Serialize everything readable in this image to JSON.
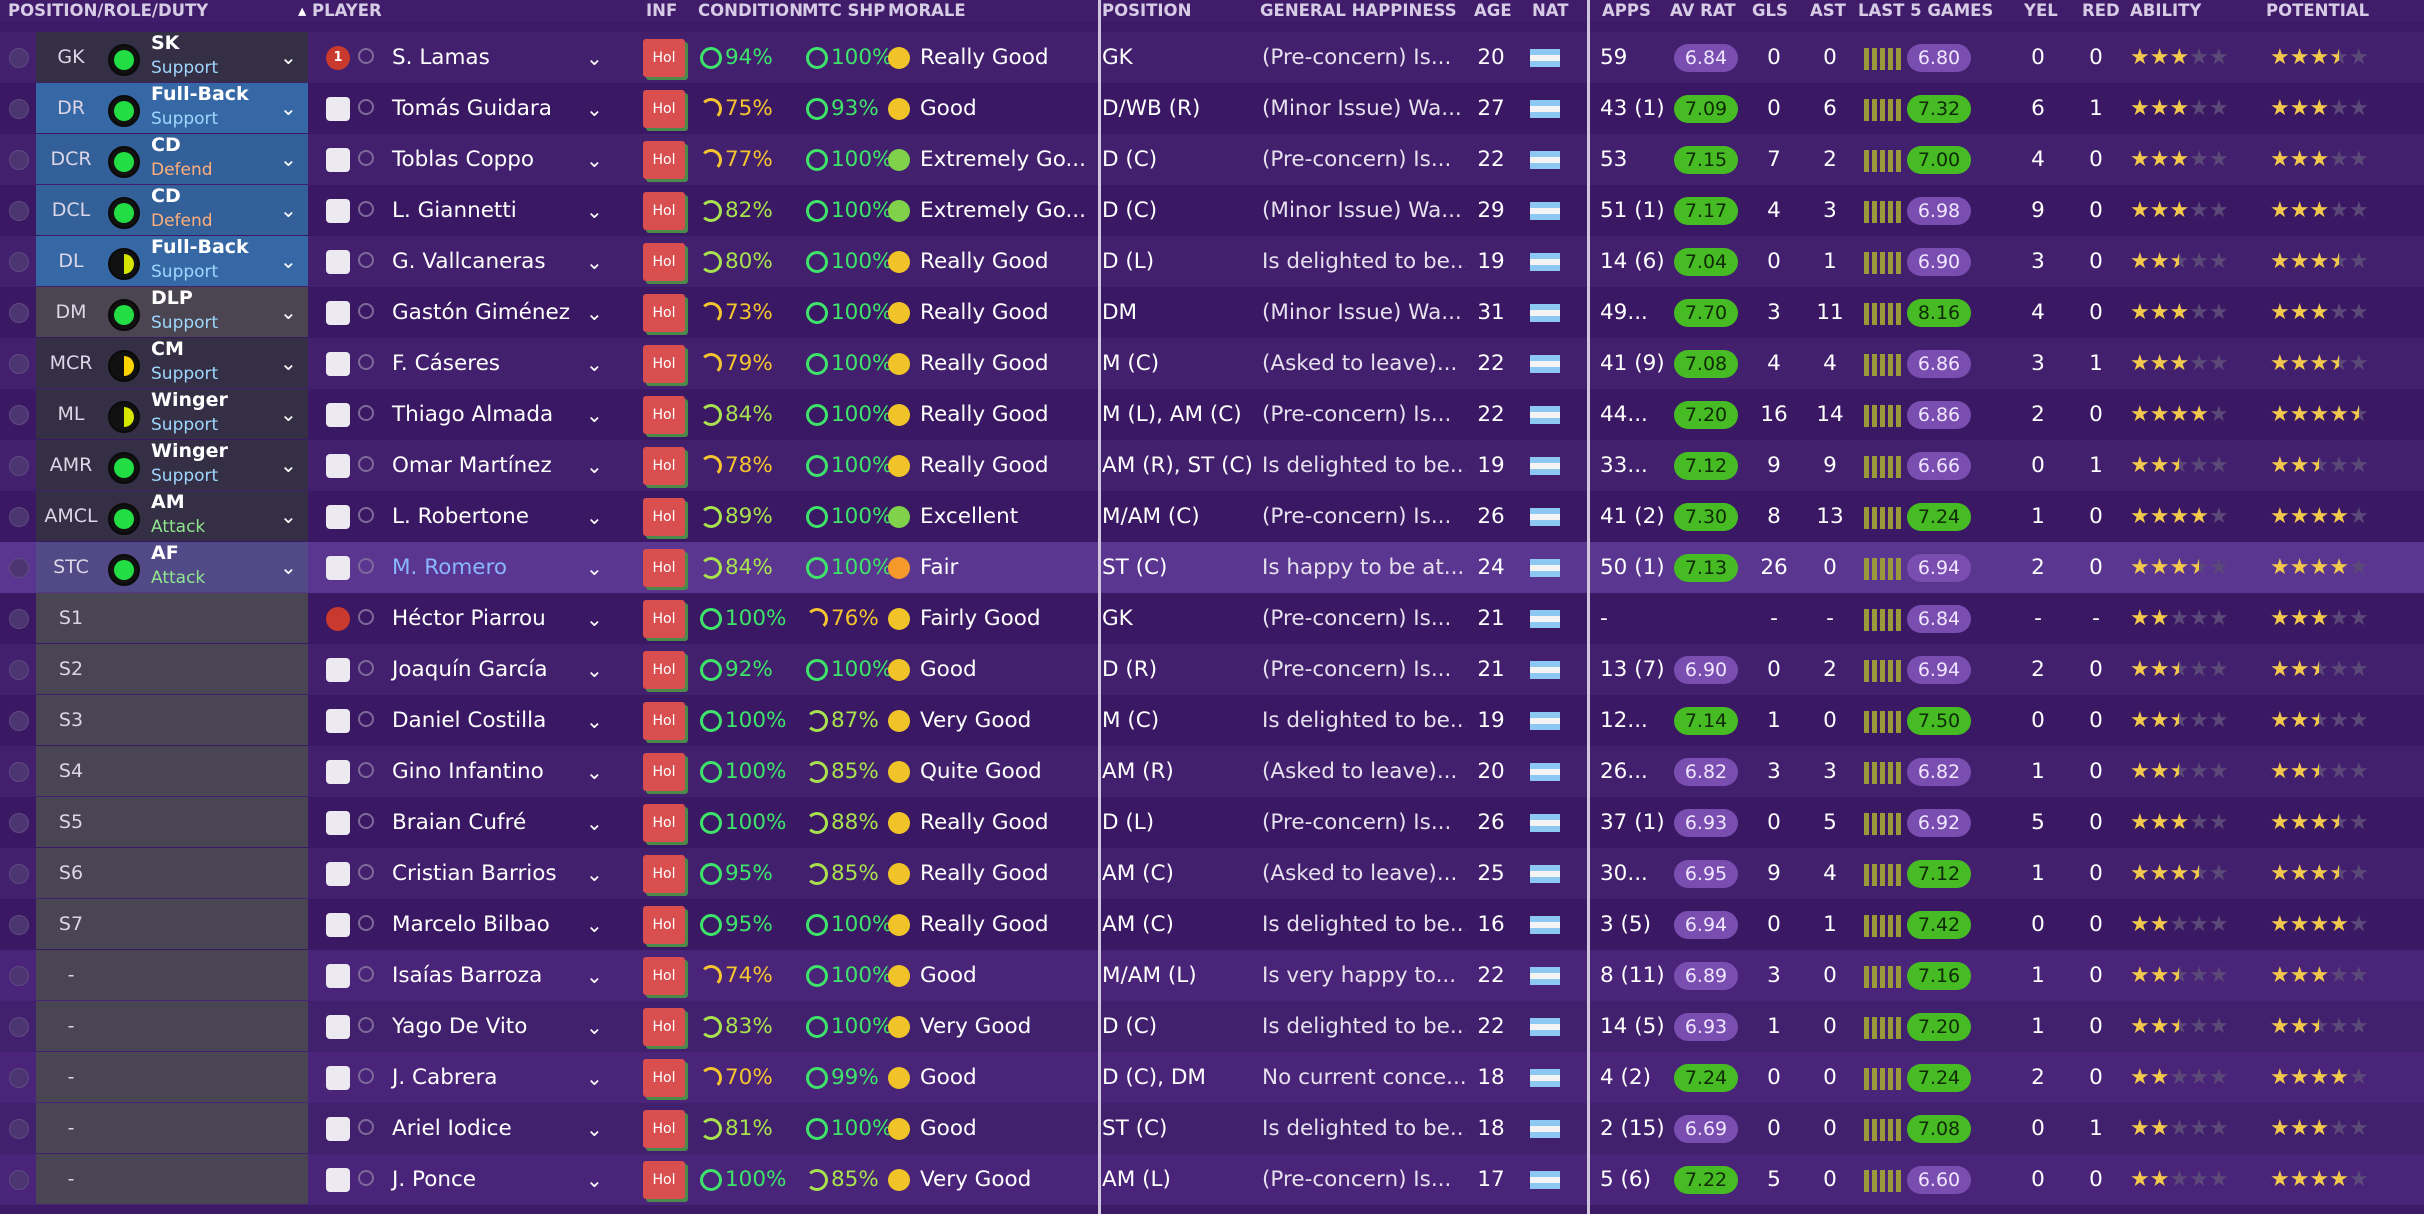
{
  "columns": {
    "position": "POSITION/ROLE/DUTY",
    "player": "PLAYER",
    "sort_indicator": "▴",
    "inf": "INF",
    "condition": "CONDITION",
    "match_sharpness": "MTC SHP",
    "morale": "MORALE",
    "position2": "POSITION",
    "happiness": "GENERAL HAPPINESS",
    "age": "AGE",
    "nat": "NAT",
    "apps": "APPS",
    "av_rat": "AV RAT",
    "gls": "GLS",
    "ast": "AST",
    "last5": "LAST 5 GAMES",
    "yel": "YEL",
    "red": "RED",
    "ability": "ABILITY",
    "potential": "POTENTIAL"
  },
  "players": [
    {
      "pos": "GK",
      "role": "SK",
      "duty": "Support",
      "name": "S. Lamas",
      "shirt": "1",
      "gk": true,
      "inf": "Hol",
      "cond": "94%",
      "mtc": "100%",
      "morale": "Really Good",
      "position": "GK",
      "happy": "(Pre-concern) Is...",
      "age": "20",
      "apps": "59",
      "avr": "6.84",
      "gls": "0",
      "ast": "0",
      "last5": "6.80",
      "yel": "0",
      "red": "0",
      "abil": "3",
      "pot": "3.5"
    },
    {
      "pos": "DR",
      "role": "Full-Back",
      "duty": "Support",
      "name": "Tomás Guidara",
      "shirt": "",
      "inf": "Hol",
      "cond": "75%",
      "mtc": "93%",
      "morale": "Good",
      "position": "D/WB (R)",
      "happy": "(Minor Issue) Wa...",
      "age": "27",
      "apps": "43 (1)",
      "avr": "7.09",
      "gls": "0",
      "ast": "6",
      "last5": "7.32",
      "yel": "6",
      "red": "1",
      "abil": "3",
      "pot": "3"
    },
    {
      "pos": "DCR",
      "role": "CD",
      "duty": "Defend",
      "name": "Toblas Coppo",
      "shirt": "",
      "inf": "Hol",
      "cond": "77%",
      "mtc": "100%",
      "morale": "Extremely Go...",
      "position": "D (C)",
      "happy": "(Pre-concern) Is...",
      "age": "22",
      "apps": "53",
      "avr": "7.15",
      "gls": "7",
      "ast": "2",
      "last5": "7.00",
      "yel": "4",
      "red": "0",
      "abil": "3",
      "pot": "3"
    },
    {
      "pos": "DCL",
      "role": "CD",
      "duty": "Defend",
      "name": "L. Giannetti",
      "shirt": "",
      "inf": "Hol",
      "cond": "82%",
      "mtc": "100%",
      "morale": "Extremely Go...",
      "position": "D (C)",
      "happy": "(Minor Issue) Wa...",
      "age": "29",
      "apps": "51 (1)",
      "avr": "7.17",
      "gls": "4",
      "ast": "3",
      "last5": "6.98",
      "yel": "9",
      "red": "0",
      "abil": "3",
      "pot": "3"
    },
    {
      "pos": "DL",
      "role": "Full-Back",
      "duty": "Support",
      "name": "G. Vallcaneras",
      "shirt": "",
      "inf": "Hol",
      "cond": "80%",
      "mtc": "100%",
      "morale": "Really Good",
      "position": "D (L)",
      "happy": "Is delighted to be...",
      "age": "19",
      "apps": "14 (6)",
      "avr": "7.04",
      "gls": "0",
      "ast": "1",
      "last5": "6.90",
      "yel": "3",
      "red": "0",
      "abil": "2.5",
      "pot": "3.5"
    },
    {
      "pos": "DM",
      "role": "DLP",
      "duty": "Support",
      "name": "Gastón Giménez",
      "shirt": "",
      "inf": "Hol",
      "cond": "73%",
      "mtc": "100%",
      "morale": "Really Good",
      "position": "DM",
      "happy": "(Minor Issue) Wa...",
      "age": "31",
      "apps": "49...",
      "avr": "7.70",
      "gls": "3",
      "ast": "11",
      "last5": "8.16",
      "yel": "4",
      "red": "0",
      "abil": "3",
      "pot": "3"
    },
    {
      "pos": "MCR",
      "role": "CM",
      "duty": "Support",
      "name": "F. Cáseres",
      "shirt": "",
      "inf": "Hol",
      "cond": "79%",
      "mtc": "100%",
      "morale": "Really Good",
      "position": "M (C)",
      "happy": "(Asked to leave)...",
      "age": "22",
      "apps": "41 (9)",
      "avr": "7.08",
      "gls": "4",
      "ast": "4",
      "last5": "6.86",
      "yel": "3",
      "red": "1",
      "abil": "3",
      "pot": "3.5"
    },
    {
      "pos": "ML",
      "role": "Winger",
      "duty": "Support",
      "name": "Thiago Almada",
      "shirt": "",
      "inf": "Hol",
      "cond": "84%",
      "mtc": "100%",
      "morale": "Really Good",
      "position": "M (L), AM (C)",
      "happy": "(Pre-concern) Is...",
      "age": "22",
      "apps": "44...",
      "avr": "7.20",
      "gls": "16",
      "ast": "14",
      "last5": "6.86",
      "yel": "2",
      "red": "0",
      "abil": "4",
      "pot": "4.5"
    },
    {
      "pos": "AMR",
      "role": "Winger",
      "duty": "Support",
      "name": "Omar Martínez",
      "shirt": "",
      "inf": "Hol",
      "cond": "78%",
      "mtc": "100%",
      "morale": "Really Good",
      "position": "AM (R), ST (C)",
      "happy": "Is delighted to be...",
      "age": "19",
      "apps": "33...",
      "avr": "7.12",
      "gls": "9",
      "ast": "9",
      "last5": "6.66",
      "yel": "0",
      "red": "1",
      "abil": "2.5",
      "pot": "2.5"
    },
    {
      "pos": "AMCL",
      "role": "AM",
      "duty": "Attack",
      "name": "L. Robertone",
      "shirt": "",
      "inf": "Hol",
      "cond": "89%",
      "mtc": "100%",
      "morale": "Excellent",
      "position": "M/AM (C)",
      "happy": "(Pre-concern) Is...",
      "age": "26",
      "apps": "41 (2)",
      "avr": "7.30",
      "gls": "8",
      "ast": "13",
      "last5": "7.24",
      "yel": "1",
      "red": "0",
      "abil": "4",
      "pot": "4"
    },
    {
      "pos": "STC",
      "role": "AF",
      "duty": "Attack",
      "name": "M. Romero",
      "shirt": "",
      "inf": "Hol",
      "cond": "84%",
      "mtc": "100%",
      "morale": "Fair",
      "position": "ST (C)",
      "happy": "Is happy to be at...",
      "age": "24",
      "apps": "50 (1)",
      "avr": "7.13",
      "gls": "26",
      "ast": "0",
      "last5": "6.94",
      "yel": "2",
      "red": "0",
      "abil": "3.5",
      "pot": "4"
    },
    {
      "pos": "S1",
      "role": "",
      "duty": "",
      "name": "Héctor Piarrou",
      "shirt": "",
      "gk": true,
      "inf": "Hol",
      "cond": "100%",
      "mtc": "76%",
      "morale": "Fairly Good",
      "position": "GK",
      "happy": "(Pre-concern) Is...",
      "age": "21",
      "apps": "-",
      "avr": "",
      "gls": "-",
      "ast": "-",
      "last5": "6.84",
      "yel": "-",
      "red": "-",
      "abil": "2",
      "pot": "3"
    },
    {
      "pos": "S2",
      "role": "",
      "duty": "",
      "name": "Joaquín García",
      "shirt": "",
      "inf": "Hol",
      "cond": "92%",
      "mtc": "100%",
      "morale": "Good",
      "position": "D (R)",
      "happy": "(Pre-concern) Is...",
      "age": "21",
      "apps": "13 (7)",
      "avr": "6.90",
      "gls": "0",
      "ast": "2",
      "last5": "6.94",
      "yel": "2",
      "red": "0",
      "abil": "2.5",
      "pot": "2.5"
    },
    {
      "pos": "S3",
      "role": "",
      "duty": "",
      "name": "Daniel Costilla",
      "shirt": "",
      "inf": "Hol",
      "cond": "100%",
      "mtc": "87%",
      "morale": "Very Good",
      "position": "M (C)",
      "happy": "Is delighted to be...",
      "age": "19",
      "apps": "12...",
      "avr": "7.14",
      "gls": "1",
      "ast": "0",
      "last5": "7.50",
      "yel": "0",
      "red": "0",
      "abil": "2.5",
      "pot": "2.5"
    },
    {
      "pos": "S4",
      "role": "",
      "duty": "",
      "name": "Gino Infantino",
      "shirt": "",
      "inf": "Hol",
      "cond": "100%",
      "mtc": "85%",
      "morale": "Quite Good",
      "position": "AM (R)",
      "happy": "(Asked to leave)...",
      "age": "20",
      "apps": "26...",
      "avr": "6.82",
      "gls": "3",
      "ast": "3",
      "last5": "6.82",
      "yel": "1",
      "red": "0",
      "abil": "2.5",
      "pot": "2.5"
    },
    {
      "pos": "S5",
      "role": "",
      "duty": "",
      "name": "Braian Cufré",
      "shirt": "",
      "inf": "Hol",
      "cond": "100%",
      "mtc": "88%",
      "morale": "Really Good",
      "position": "D (L)",
      "happy": "(Pre-concern) Is...",
      "age": "26",
      "apps": "37 (1)",
      "avr": "6.93",
      "gls": "0",
      "ast": "5",
      "last5": "6.92",
      "yel": "5",
      "red": "0",
      "abil": "3",
      "pot": "3.5"
    },
    {
      "pos": "S6",
      "role": "",
      "duty": "",
      "name": "Cristian Barrios",
      "shirt": "",
      "inf": "Hol",
      "cond": "95%",
      "mtc": "85%",
      "morale": "Really Good",
      "position": "AM (C)",
      "happy": "(Asked to leave)...",
      "age": "25",
      "apps": "30...",
      "avr": "6.95",
      "gls": "9",
      "ast": "4",
      "last5": "7.12",
      "yel": "1",
      "red": "0",
      "abil": "3.5",
      "pot": "3.5"
    },
    {
      "pos": "S7",
      "role": "",
      "duty": "",
      "name": "Marcelo Bilbao",
      "shirt": "",
      "inf": "Hol",
      "cond": "95%",
      "mtc": "100%",
      "morale": "Really Good",
      "position": "AM (C)",
      "happy": "Is delighted to be...",
      "age": "16",
      "apps": "3 (5)",
      "avr": "6.94",
      "gls": "0",
      "ast": "1",
      "last5": "7.42",
      "yel": "0",
      "red": "0",
      "abil": "2",
      "pot": "4"
    },
    {
      "pos": "-",
      "role": "",
      "duty": "",
      "name": "Isaías Barroza",
      "shirt": "",
      "inf": "Hol",
      "cond": "74%",
      "mtc": "100%",
      "morale": "Good",
      "position": "M/AM (L)",
      "happy": "Is very happy to...",
      "age": "22",
      "apps": "8 (11)",
      "avr": "6.89",
      "gls": "3",
      "ast": "0",
      "last5": "7.16",
      "yel": "1",
      "red": "0",
      "abil": "2.5",
      "pot": "3"
    },
    {
      "pos": "-",
      "role": "",
      "duty": "",
      "name": "Yago De Vito",
      "shirt": "",
      "inf": "Hol",
      "cond": "83%",
      "mtc": "100%",
      "morale": "Very Good",
      "position": "D (C)",
      "happy": "Is delighted to be...",
      "age": "22",
      "apps": "14 (5)",
      "avr": "6.93",
      "gls": "1",
      "ast": "0",
      "last5": "7.20",
      "yel": "1",
      "red": "0",
      "abil": "2.5",
      "pot": "2.5"
    },
    {
      "pos": "-",
      "role": "",
      "duty": "",
      "name": "J. Cabrera",
      "shirt": "",
      "inf": "Hol",
      "cond": "70%",
      "mtc": "99%",
      "morale": "Good",
      "position": "D (C), DM",
      "happy": "No current conce...",
      "age": "18",
      "apps": "4 (2)",
      "avr": "7.24",
      "gls": "0",
      "ast": "0",
      "last5": "7.24",
      "yel": "2",
      "red": "0",
      "abil": "2",
      "pot": "4"
    },
    {
      "pos": "-",
      "role": "",
      "duty": "",
      "name": "Ariel Iodice",
      "shirt": "",
      "inf": "Hol",
      "cond": "81%",
      "mtc": "100%",
      "morale": "Good",
      "position": "ST (C)",
      "happy": "Is delighted to be...",
      "age": "18",
      "apps": "2 (15)",
      "avr": "6.69",
      "gls": "0",
      "ast": "0",
      "last5": "7.08",
      "yel": "0",
      "red": "1",
      "abil": "2",
      "pot": "3"
    },
    {
      "pos": "-",
      "role": "",
      "duty": "",
      "name": "J. Ponce",
      "shirt": "",
      "inf": "Hol",
      "cond": "100%",
      "mtc": "85%",
      "morale": "Very Good",
      "position": "AM (L)",
      "happy": "(Pre-concern) Is...",
      "age": "17",
      "apps": "5 (6)",
      "avr": "7.22",
      "gls": "5",
      "ast": "0",
      "last5": "6.60",
      "yel": "0",
      "red": "0",
      "abil": "2",
      "pot": "4"
    }
  ]
}
